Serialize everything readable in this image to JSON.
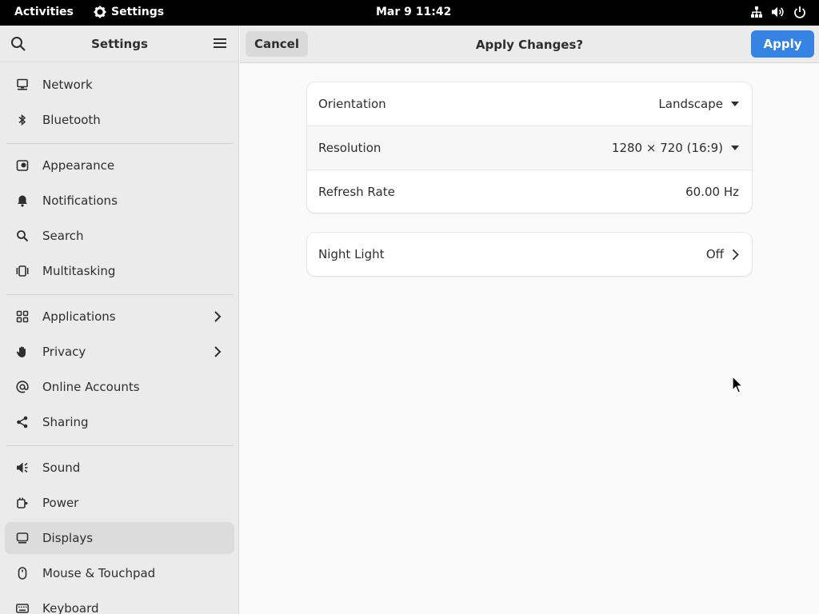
{
  "topbar": {
    "activities": "Activities",
    "app_name": "Settings",
    "clock": "Mar 9  11:42",
    "icons": [
      "network-icon",
      "volume-icon",
      "power-icon"
    ]
  },
  "sidebar": {
    "title": "Settings",
    "items": [
      {
        "label": "Network",
        "icon": "network-icon"
      },
      {
        "label": "Bluetooth",
        "icon": "bluetooth-icon"
      },
      {
        "label": "Appearance",
        "icon": "appearance-icon"
      },
      {
        "label": "Notifications",
        "icon": "bell-icon"
      },
      {
        "label": "Search",
        "icon": "search-icon"
      },
      {
        "label": "Multitasking",
        "icon": "multitasking-icon"
      },
      {
        "label": "Applications",
        "icon": "apps-grid-icon"
      },
      {
        "label": "Privacy",
        "icon": "hand-icon"
      },
      {
        "label": "Online Accounts",
        "icon": "at-icon"
      },
      {
        "label": "Sharing",
        "icon": "share-icon"
      },
      {
        "label": "Sound",
        "icon": "speaker-icon"
      },
      {
        "label": "Power",
        "icon": "power-plug-icon"
      },
      {
        "label": "Displays",
        "icon": "display-icon"
      },
      {
        "label": "Mouse & Touchpad",
        "icon": "mouse-icon"
      },
      {
        "label": "Keyboard",
        "icon": "keyboard-icon"
      }
    ],
    "selected": "Displays"
  },
  "header": {
    "cancel_label": "Cancel",
    "title": "Apply Changes?",
    "apply_label": "Apply"
  },
  "display_settings": {
    "orientation_label": "Orientation",
    "orientation_value": "Landscape",
    "resolution_label": "Resolution",
    "resolution_value": "1280 × 720 (16:9)",
    "refresh_label": "Refresh Rate",
    "refresh_value": "60.00 Hz"
  },
  "night_light": {
    "label": "Night Light",
    "value": "Off"
  },
  "colors": {
    "accent": "#3584e4",
    "topbar": "#000000",
    "sidebar": "#ebebeb"
  }
}
